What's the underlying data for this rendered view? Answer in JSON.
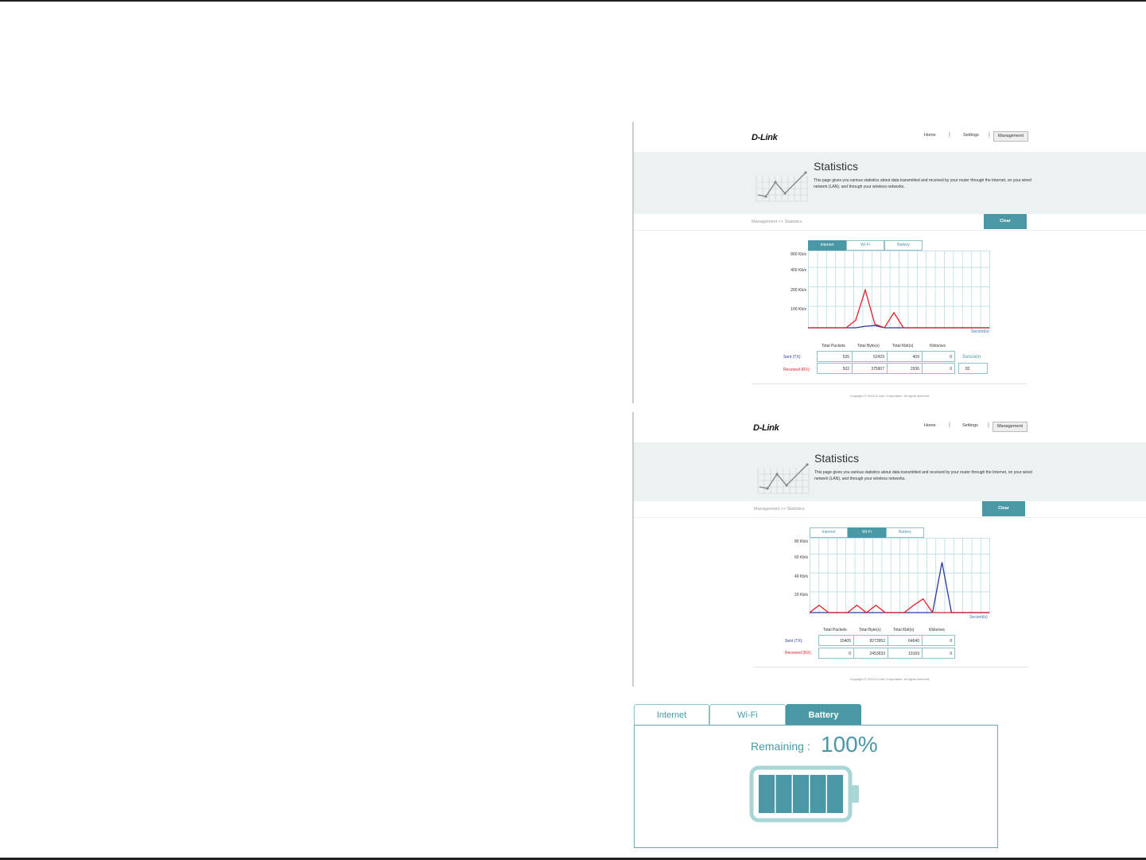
{
  "shot1": {
    "logo": "D-Link",
    "nav": {
      "home": "Home",
      "settings": "Settings",
      "management": "Management"
    },
    "title": "Statistics",
    "description": "This page gives you various statistics about data transmitted and received by your router through the Internet, on your wired network (LAN), and through your wireless networks.",
    "breadcrumb": "Management >> Statistics",
    "clear_label": "Clear",
    "tabs": [
      "Internet",
      "Wi-Fi",
      "Battery"
    ],
    "active_tab": "Internet",
    "chart_y_labels": [
      "800 Kb/s",
      "400 Kb/s",
      "200 Kb/s",
      "100 Kb/s"
    ],
    "chart_x_label": "Second(s)",
    "table": {
      "headers": [
        "Total Packets",
        "Total Byte(s)",
        "Total Kbit(s)",
        "Kbits/sec"
      ],
      "sent_label": "Sent (TX):",
      "received_label": "Received (RX):",
      "sent": [
        "535",
        "52429",
        "409",
        "0"
      ],
      "received": [
        "502",
        "375907",
        "2936",
        "0"
      ]
    },
    "session_label": "Session",
    "session_value": "82",
    "copyright": "Copyright © 2013 D-Link Corporation. All rights reserved."
  },
  "shot2": {
    "logo": "D-Link",
    "nav": {
      "home": "Home",
      "settings": "Settings",
      "management": "Management"
    },
    "title": "Statistics",
    "description": "This page gives you various statistics about data transmitted and received by your router through the Internet, on your wired network (LAN), and through your wireless networks.",
    "breadcrumb": "Management >> Statistics",
    "clear_label": "Clear",
    "tabs": [
      "Internet",
      "Wi-Fi",
      "Battery"
    ],
    "active_tab": "Wi-Fi",
    "chart_y_labels": [
      "80 Kb/s",
      "60 Kb/s",
      "40 Kb/s",
      "20 Kb/s"
    ],
    "chart_x_label": "Second(s)",
    "table": {
      "headers": [
        "Total Packets",
        "Total Byte(s)",
        "Total Kbit(s)",
        "Kbits/sec"
      ],
      "sent_label": "Sent (TX):",
      "received_label": "Received (RX):",
      "sent": [
        "15405",
        "8273952",
        "64640",
        "0"
      ],
      "received": [
        "0",
        "2453633",
        "19169",
        "0"
      ]
    },
    "copyright": "Copyright © 2013 D-Link Corporation. All rights reserved."
  },
  "battery": {
    "tabs": [
      "Internet",
      "Wi-Fi",
      "Battery"
    ],
    "active_tab": "Battery",
    "remaining_label": "Remaining :",
    "remaining_value": "100%",
    "level_fraction": 1.0
  },
  "colors": {
    "accent": "#4a97a6",
    "tx": "#2b3a9a",
    "rx": "#e0202a",
    "grid": "#b8dde3"
  },
  "chart_data": [
    {
      "type": "line",
      "x": [
        0,
        1,
        2,
        3,
        4,
        5,
        6,
        7,
        8,
        9,
        10,
        11,
        12,
        13,
        14,
        15,
        16,
        17,
        18,
        19
      ],
      "series": [
        {
          "values": [
            0,
            0,
            0,
            0,
            0,
            0,
            2,
            3,
            0,
            0,
            0,
            0,
            0,
            0,
            0,
            0,
            0,
            0,
            0,
            0
          ]
        },
        {
          "values": [
            0,
            0,
            0,
            0,
            0,
            10,
            50,
            5,
            0,
            20,
            0,
            0,
            0,
            0,
            0,
            0,
            0,
            0,
            0,
            0
          ]
        }
      ],
      "xlabel": "Second(s)"
    },
    {
      "type": "line",
      "x": [
        0,
        1,
        2,
        3,
        4,
        5,
        6,
        7,
        8,
        9,
        10,
        11,
        12,
        13,
        14,
        15,
        16,
        17,
        18,
        19
      ],
      "series": [
        {
          "values": [
            0,
            0,
            0,
            0,
            0,
            0,
            0,
            0,
            0,
            0,
            0,
            0,
            0,
            0,
            55,
            0,
            0,
            0,
            0,
            0
          ]
        },
        {
          "values": [
            0,
            8,
            0,
            0,
            0,
            8,
            0,
            8,
            0,
            0,
            0,
            8,
            15,
            0,
            0,
            0,
            0,
            0,
            0,
            0
          ]
        }
      ],
      "xlabel": "Second(s)"
    }
  ]
}
